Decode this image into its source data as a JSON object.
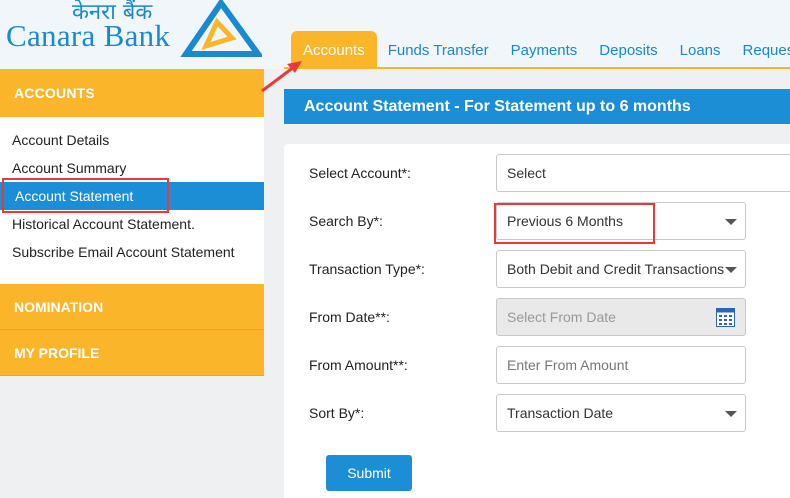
{
  "brand": {
    "name_hindi": "केनरा बैंक",
    "name_english": "Canara Bank",
    "colors": {
      "blue": "#1b89cf",
      "yellow": "#fbb52a"
    }
  },
  "topnav": {
    "tabs": [
      {
        "label": "Accounts",
        "active": true
      },
      {
        "label": "Funds Transfer",
        "active": false
      },
      {
        "label": "Payments",
        "active": false
      },
      {
        "label": "Deposits",
        "active": false
      },
      {
        "label": "Loans",
        "active": false
      },
      {
        "label": "Reques",
        "active": false
      }
    ]
  },
  "sidebar": {
    "header": "ACCOUNTS",
    "items": [
      {
        "label": "Account Details",
        "active": false
      },
      {
        "label": "Account Summary",
        "active": false
      },
      {
        "label": "Account Statement",
        "active": true
      },
      {
        "label": "Historical Account Statement.",
        "active": false
      },
      {
        "label": "Subscribe Email Account Statement",
        "active": false
      }
    ],
    "sections": [
      "NOMINATION",
      "MY PROFILE"
    ]
  },
  "main": {
    "title": "Account Statement - For Statement up to 6 months",
    "form": {
      "select_account": {
        "label": "Select Account*:",
        "value": "Select"
      },
      "search_by": {
        "label": "Search By*:",
        "value": "Previous 6 Months"
      },
      "transaction_type": {
        "label": "Transaction Type*:",
        "value": "Both Debit and Credit Transactions"
      },
      "from_date": {
        "label": "From Date**:",
        "placeholder": "Select From Date",
        "icon": "calendar-icon"
      },
      "from_amount": {
        "label": "From Amount**:",
        "placeholder": "Enter From Amount"
      },
      "sort_by": {
        "label": "Sort By*:",
        "value": "Transaction Date"
      },
      "submit_label": "Submit"
    }
  },
  "annotations": {
    "highlight_color": "#e53b3b"
  }
}
